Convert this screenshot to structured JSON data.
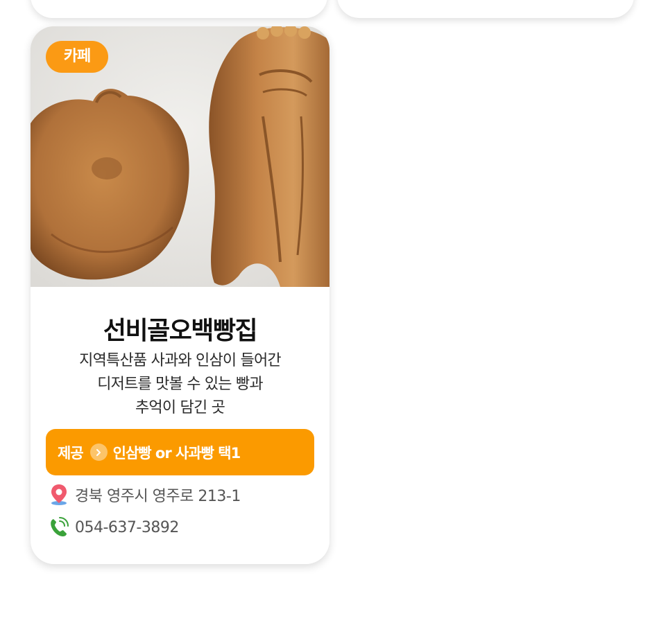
{
  "place": {
    "category": "카페",
    "name": "선비골오백빵집",
    "description_lines": [
      "지역특산품 사과와 인삼이 들어간",
      "디저트를 맛볼 수 있는 빵과",
      "추억이 담긴 곳"
    ],
    "offer": {
      "label": "제공",
      "text": "인삼빵 or 사과빵 택1",
      "arrow_icon": "chevron-right-icon"
    },
    "address": "경북 영주시 영주로 213-1",
    "phone": "054-637-3892",
    "icons": {
      "address": "location-pin-icon",
      "phone": "phone-icon"
    },
    "photo": "pastry-photo"
  },
  "colors": {
    "accent": "#fb9a00",
    "badge": "#fb9a14",
    "pin": "#f05a6e",
    "phone_icon": "#3aa23a"
  }
}
